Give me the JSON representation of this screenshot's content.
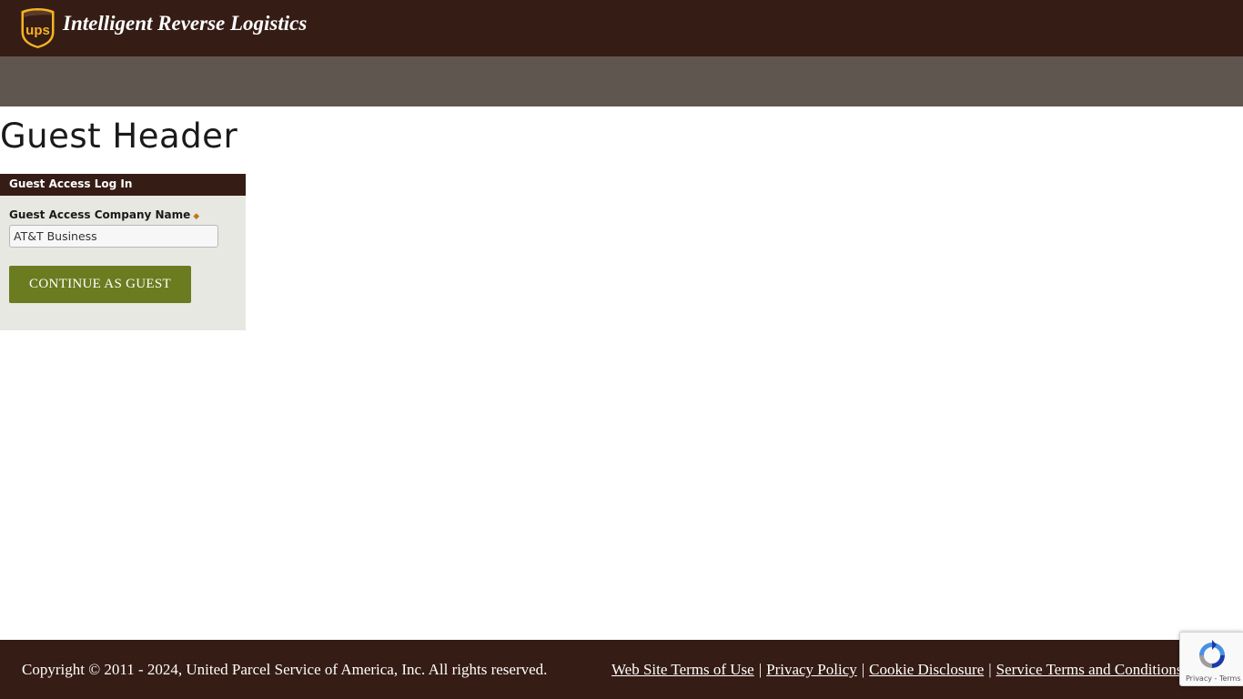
{
  "header": {
    "logo_icon": "ups-shield-logo",
    "logo_text": "ups",
    "title": "Intelligent Reverse Logistics"
  },
  "page": {
    "title": "Guest Header"
  },
  "login_panel": {
    "header": "Guest Access Log In",
    "company_label": "Guest Access Company Name",
    "required_marker": "◆",
    "company_value": "AT&T Business",
    "continue_label": "CONTINUE AS GUEST"
  },
  "footer": {
    "copyright": "Copyright © 2011 - 2024, United Parcel Service of America, Inc. All rights reserved.",
    "links": [
      "Web Site Terms of Use",
      "Privacy Policy",
      "Cookie Disclosure",
      "Service Terms and Conditions"
    ],
    "separator": "|"
  },
  "recaptcha": {
    "icon": "recaptcha-icon",
    "privacy": "Privacy",
    "terms": "Terms",
    "separator": " - "
  },
  "colors": {
    "brand_brown": "#351c15",
    "nav_gray": "#5f574f",
    "ups_gold": "#f5b324",
    "button_green": "#6a7c1f",
    "panel_bg": "#e8e8e3"
  }
}
